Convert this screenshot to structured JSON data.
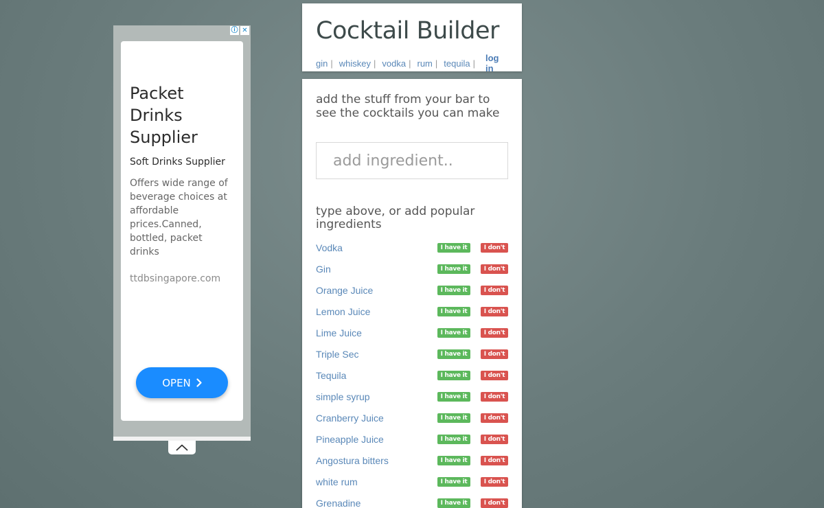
{
  "ad": {
    "headline": "Packet Drinks Supplier",
    "subheadline": "Soft Drinks Supplier",
    "description": "Offers wide range of beverage choices at affordable prices.Canned, bottled, packet drinks",
    "url": "ttdbsingapore.com",
    "open_label": "OPEN",
    "info_icon": "ⓘ",
    "close_icon": "✕"
  },
  "header": {
    "title": "Cocktail Builder",
    "nav": [
      {
        "label": "gin"
      },
      {
        "label": "whiskey"
      },
      {
        "label": "vodka"
      },
      {
        "label": "rum"
      },
      {
        "label": "tequila"
      }
    ],
    "separator": "|",
    "login_label": "log in"
  },
  "main": {
    "intro": "add the stuff from your bar to see the cocktails you can make",
    "search_placeholder": "add ingredient..",
    "popular_title": "type above, or add popular ingredients",
    "have_label": "I have it",
    "dont_label": "I don't",
    "ingredients": [
      {
        "name": "Vodka"
      },
      {
        "name": "Gin"
      },
      {
        "name": "Orange Juice"
      },
      {
        "name": "Lemon Juice"
      },
      {
        "name": "Lime Juice"
      },
      {
        "name": "Triple Sec"
      },
      {
        "name": "Tequila"
      },
      {
        "name": "simple syrup"
      },
      {
        "name": "Cranberry Juice"
      },
      {
        "name": "Pineapple Juice"
      },
      {
        "name": "Angostura bitters"
      },
      {
        "name": "white rum"
      },
      {
        "name": "Grenadine"
      }
    ]
  },
  "colors": {
    "have": "#5cb85c",
    "dont": "#d9534f",
    "link": "#5a88b8",
    "ad_button": "#1a8cff"
  }
}
